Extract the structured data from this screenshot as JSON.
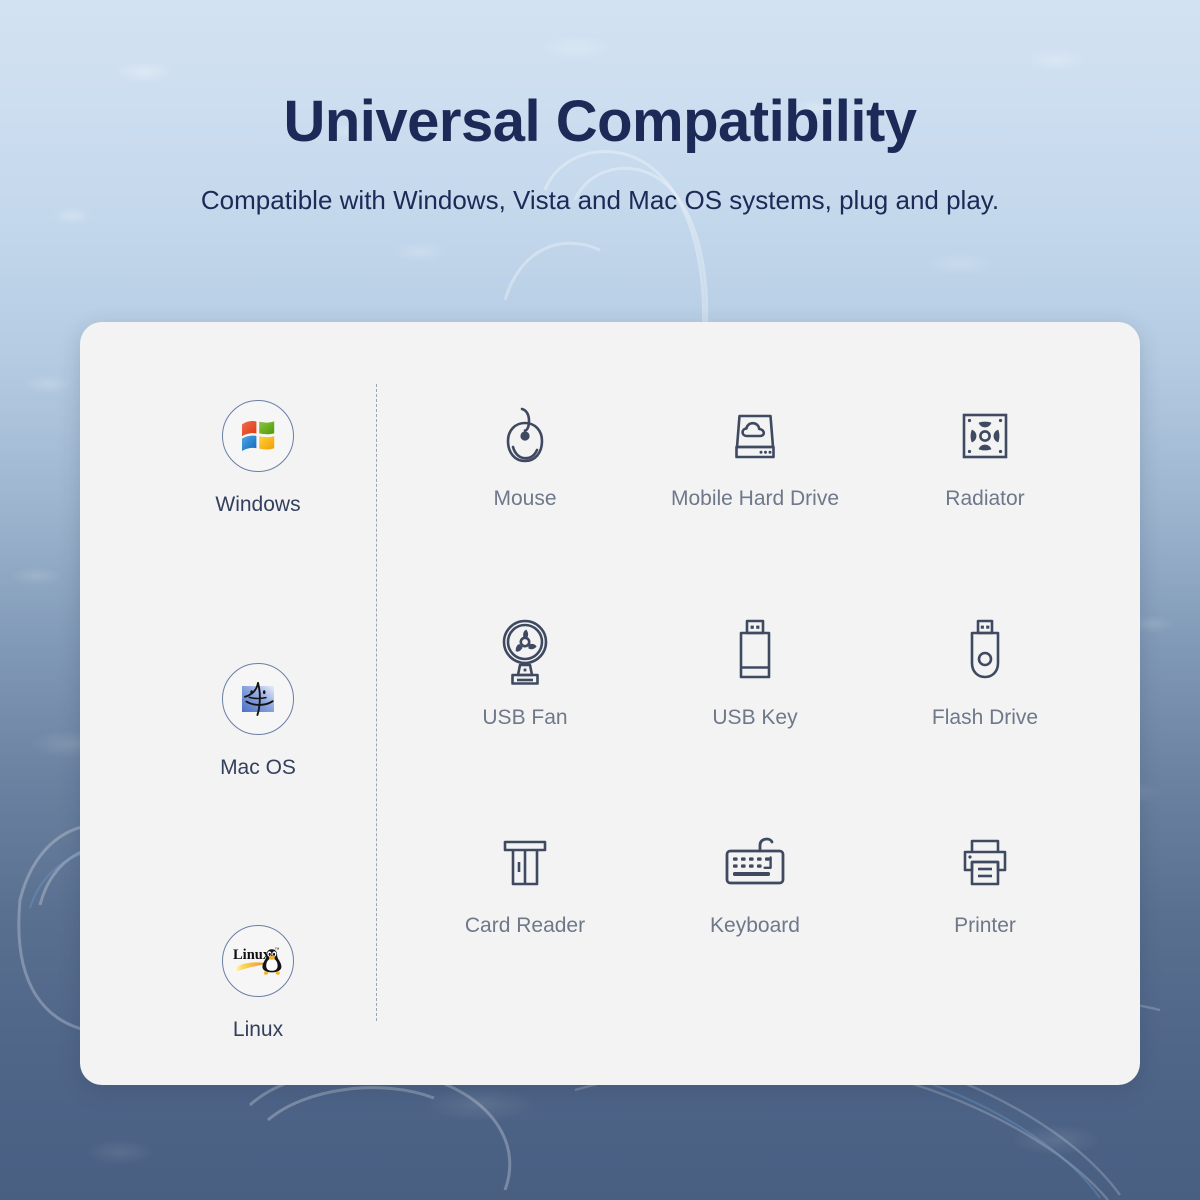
{
  "header": {
    "title": "Universal Compatibility",
    "subtitle": "Compatible with Windows, Vista and Mac OS systems, plug and play."
  },
  "colors": {
    "title_navy": "#1b2a56",
    "os_label": "#333f5c",
    "device_label": "#6e7889",
    "card_bg": "#f3f3f4",
    "badge_ring": "#6b7fa3",
    "icon_stroke": "#3f4a61",
    "divider": "#9aa4b4",
    "bg_top": "#d3e2f2",
    "bg_bottom": "#495f82"
  },
  "os_list": [
    {
      "label": "Windows",
      "icon": "windows-logo-icon"
    },
    {
      "label": "Mac OS",
      "icon": "mac-finder-face-icon"
    },
    {
      "label": "Linux",
      "icon": "linux-tux-icon"
    }
  ],
  "devices": [
    {
      "label": "Mouse",
      "icon": "mouse-icon"
    },
    {
      "label": "Mobile Hard Drive",
      "icon": "mobile-hard-drive-icon"
    },
    {
      "label": "Radiator",
      "icon": "radiator-fan-icon"
    },
    {
      "label": "USB Fan",
      "icon": "usb-fan-icon"
    },
    {
      "label": "USB Key",
      "icon": "usb-key-icon"
    },
    {
      "label": "Flash Drive",
      "icon": "flash-drive-icon"
    },
    {
      "label": "Card Reader",
      "icon": "card-reader-icon"
    },
    {
      "label": "Keyboard",
      "icon": "keyboard-icon"
    },
    {
      "label": "Printer",
      "icon": "printer-icon"
    }
  ]
}
